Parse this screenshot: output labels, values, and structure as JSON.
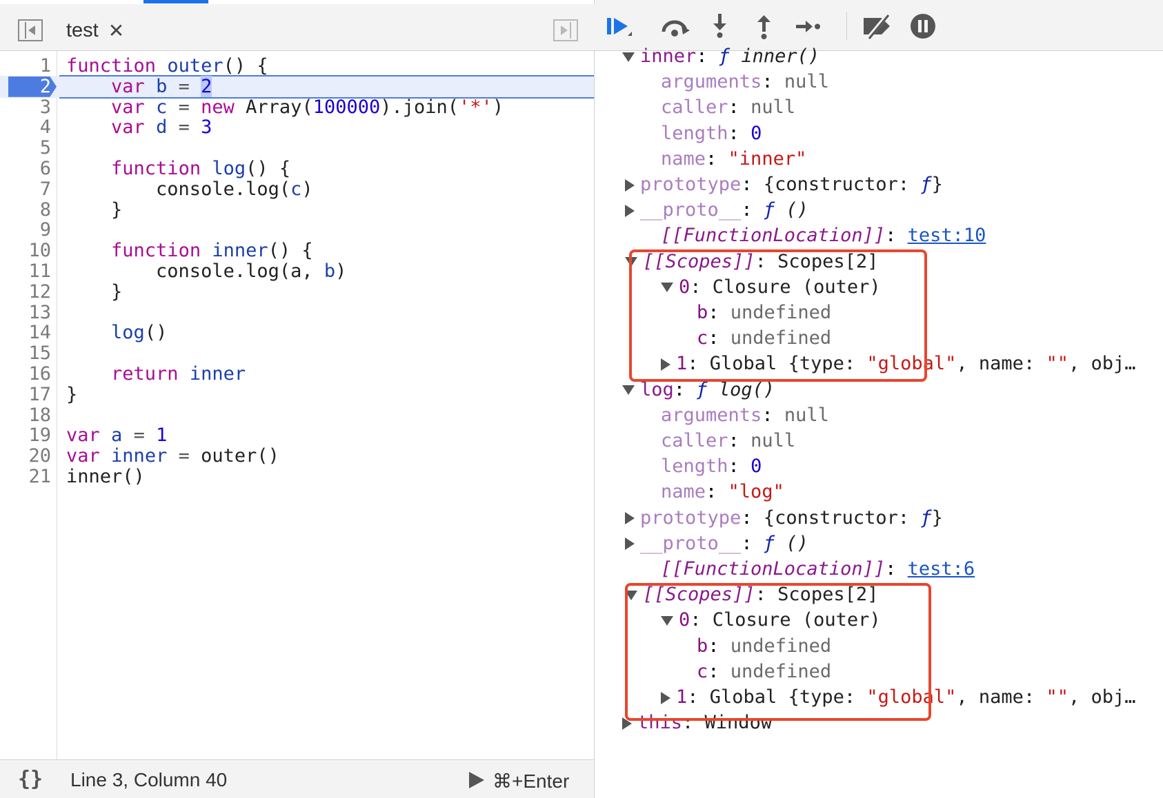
{
  "editor": {
    "file_tab": {
      "title": "test",
      "close_glyph": "✕"
    },
    "lines": [
      {
        "n": "1",
        "tokens": [
          {
            "t": "function",
            "c": "kw"
          },
          {
            "t": " "
          },
          {
            "t": "outer",
            "c": "def"
          },
          {
            "t": "() {"
          }
        ]
      },
      {
        "n": "2",
        "tokens": [
          {
            "t": "    "
          },
          {
            "t": "var",
            "c": "kw"
          },
          {
            "t": " "
          },
          {
            "t": "b",
            "c": "def"
          },
          {
            "t": " = ",
            "c": "op"
          },
          {
            "t": "2",
            "c": "num hl-value"
          }
        ],
        "paused": true
      },
      {
        "n": "3",
        "tokens": [
          {
            "t": "    "
          },
          {
            "t": "var",
            "c": "kw"
          },
          {
            "t": " "
          },
          {
            "t": "c",
            "c": "def"
          },
          {
            "t": " = ",
            "c": "op"
          },
          {
            "t": "new",
            "c": "kw"
          },
          {
            "t": " Array("
          },
          {
            "t": "100000",
            "c": "num"
          },
          {
            "t": ").join("
          },
          {
            "t": "'*'",
            "c": "str"
          },
          {
            "t": ")"
          }
        ]
      },
      {
        "n": "4",
        "tokens": [
          {
            "t": "    "
          },
          {
            "t": "var",
            "c": "kw"
          },
          {
            "t": " "
          },
          {
            "t": "d",
            "c": "def"
          },
          {
            "t": " = ",
            "c": "op"
          },
          {
            "t": "3",
            "c": "num"
          }
        ]
      },
      {
        "n": "5",
        "tokens": []
      },
      {
        "n": "6",
        "tokens": [
          {
            "t": "    "
          },
          {
            "t": "function",
            "c": "kw"
          },
          {
            "t": " "
          },
          {
            "t": "log",
            "c": "def"
          },
          {
            "t": "() {"
          }
        ]
      },
      {
        "n": "7",
        "tokens": [
          {
            "t": "        console.log("
          },
          {
            "t": "c",
            "c": "def"
          },
          {
            "t": ")"
          }
        ]
      },
      {
        "n": "8",
        "tokens": [
          {
            "t": "    }"
          }
        ]
      },
      {
        "n": "9",
        "tokens": []
      },
      {
        "n": "10",
        "tokens": [
          {
            "t": "    "
          },
          {
            "t": "function",
            "c": "kw"
          },
          {
            "t": " "
          },
          {
            "t": "inner",
            "c": "def"
          },
          {
            "t": "() {"
          }
        ]
      },
      {
        "n": "11",
        "tokens": [
          {
            "t": "        console.log(a, "
          },
          {
            "t": "b",
            "c": "def"
          },
          {
            "t": ")"
          }
        ]
      },
      {
        "n": "12",
        "tokens": [
          {
            "t": "    }"
          }
        ]
      },
      {
        "n": "13",
        "tokens": []
      },
      {
        "n": "14",
        "tokens": [
          {
            "t": "    "
          },
          {
            "t": "log",
            "c": "def"
          },
          {
            "t": "()"
          }
        ]
      },
      {
        "n": "15",
        "tokens": []
      },
      {
        "n": "16",
        "tokens": [
          {
            "t": "    "
          },
          {
            "t": "return",
            "c": "kw"
          },
          {
            "t": " "
          },
          {
            "t": "inner",
            "c": "def"
          }
        ]
      },
      {
        "n": "17",
        "tokens": [
          {
            "t": "}"
          }
        ]
      },
      {
        "n": "18",
        "tokens": []
      },
      {
        "n": "19",
        "tokens": [
          {
            "t": "var",
            "c": "kw"
          },
          {
            "t": " "
          },
          {
            "t": "a",
            "c": "def"
          },
          {
            "t": " = ",
            "c": "op"
          },
          {
            "t": "1",
            "c": "num"
          }
        ]
      },
      {
        "n": "20",
        "tokens": [
          {
            "t": "var",
            "c": "kw"
          },
          {
            "t": " "
          },
          {
            "t": "inner",
            "c": "def"
          },
          {
            "t": " = ",
            "c": "op"
          },
          {
            "t": "outer()"
          }
        ]
      },
      {
        "n": "21",
        "tokens": [
          {
            "t": "inner()"
          }
        ]
      }
    ]
  },
  "status_bar": {
    "pretty_print": "{}",
    "cursor_position": "Line 3, Column 40",
    "run_shortcut": "⌘+Enter"
  },
  "debug_toolbar": {
    "buttons": [
      "resume-icon",
      "step-over-icon",
      "step-into-icon",
      "step-out-icon",
      "step-icon",
      "deactivate-breakpoints-icon",
      "pause-on-exceptions-icon"
    ]
  },
  "scope_tree": {
    "rows": [
      {
        "indent": 0,
        "tri": "down",
        "parts": [
          {
            "t": "inner",
            "c": "k-main"
          },
          {
            "t": ": "
          },
          {
            "t": "ƒ",
            "c": "v-f"
          },
          {
            "t": " inner()",
            "c": "v-fn"
          }
        ]
      },
      {
        "indent": 2,
        "parts": [
          {
            "t": "arguments",
            "c": "k-dim"
          },
          {
            "t": ": "
          },
          {
            "t": "null",
            "c": "v-null"
          }
        ]
      },
      {
        "indent": 2,
        "parts": [
          {
            "t": "caller",
            "c": "k-dim"
          },
          {
            "t": ": "
          },
          {
            "t": "null",
            "c": "v-null"
          }
        ]
      },
      {
        "indent": 2,
        "parts": [
          {
            "t": "length",
            "c": "k-dim"
          },
          {
            "t": ": "
          },
          {
            "t": "0",
            "c": "v-num"
          }
        ]
      },
      {
        "indent": 2,
        "parts": [
          {
            "t": "name",
            "c": "k-dim"
          },
          {
            "t": ": "
          },
          {
            "t": "\"inner\"",
            "c": "v-str"
          }
        ]
      },
      {
        "indent": 1,
        "tri": "right",
        "parts": [
          {
            "t": "prototype",
            "c": "k-dim"
          },
          {
            "t": ": "
          },
          {
            "t": "{constructor: ",
            "c": "v-obj"
          },
          {
            "t": "ƒ",
            "c": "v-f"
          },
          {
            "t": "}",
            "c": "v-obj"
          }
        ]
      },
      {
        "indent": 1,
        "tri": "right",
        "parts": [
          {
            "t": "__proto__",
            "c": "k-dim"
          },
          {
            "t": ": "
          },
          {
            "t": "ƒ",
            "c": "v-f"
          },
          {
            "t": " ()",
            "c": "v-fn"
          }
        ]
      },
      {
        "indent": 2,
        "parts": [
          {
            "t": "[[FunctionLocation]]",
            "c": "internal"
          },
          {
            "t": ": "
          },
          {
            "t": "test:10",
            "c": "v-link"
          }
        ]
      },
      {
        "indent": 1,
        "tri": "down",
        "parts": [
          {
            "t": "[[Scopes]]",
            "c": "internal"
          },
          {
            "t": ": Scopes[2]",
            "c": "plain"
          }
        ]
      },
      {
        "indent": 2,
        "tri": "down",
        "tri_shift": true,
        "parts": [
          {
            "t": "0",
            "c": "k-name"
          },
          {
            "t": ": Closure (outer)",
            "c": "plain"
          }
        ]
      },
      {
        "indent": 3,
        "parts": [
          {
            "t": "b",
            "c": "k-name"
          },
          {
            "t": ": "
          },
          {
            "t": "undefined",
            "c": "v-undef"
          }
        ]
      },
      {
        "indent": 3,
        "parts": [
          {
            "t": "c",
            "c": "k-name"
          },
          {
            "t": ": "
          },
          {
            "t": "undefined",
            "c": "v-undef"
          }
        ]
      },
      {
        "indent": 2,
        "tri": "right",
        "tri_shift": true,
        "parts": [
          {
            "t": "1",
            "c": "k-name"
          },
          {
            "t": ": Global {type: ",
            "c": "plain"
          },
          {
            "t": "\"global\"",
            "c": "v-str"
          },
          {
            "t": ", name: ",
            "c": "plain"
          },
          {
            "t": "\"\"",
            "c": "v-str"
          },
          {
            "t": ", obj…",
            "c": "plain"
          }
        ]
      },
      {
        "indent": 0,
        "tri": "down",
        "parts": [
          {
            "t": "log",
            "c": "k-main"
          },
          {
            "t": ": "
          },
          {
            "t": "ƒ",
            "c": "v-f"
          },
          {
            "t": " log()",
            "c": "v-fn"
          }
        ]
      },
      {
        "indent": 2,
        "parts": [
          {
            "t": "arguments",
            "c": "k-dim"
          },
          {
            "t": ": "
          },
          {
            "t": "null",
            "c": "v-null"
          }
        ]
      },
      {
        "indent": 2,
        "parts": [
          {
            "t": "caller",
            "c": "k-dim"
          },
          {
            "t": ": "
          },
          {
            "t": "null",
            "c": "v-null"
          }
        ]
      },
      {
        "indent": 2,
        "parts": [
          {
            "t": "length",
            "c": "k-dim"
          },
          {
            "t": ": "
          },
          {
            "t": "0",
            "c": "v-num"
          }
        ]
      },
      {
        "indent": 2,
        "parts": [
          {
            "t": "name",
            "c": "k-dim"
          },
          {
            "t": ": "
          },
          {
            "t": "\"log\"",
            "c": "v-str"
          }
        ]
      },
      {
        "indent": 1,
        "tri": "right",
        "parts": [
          {
            "t": "prototype",
            "c": "k-dim"
          },
          {
            "t": ": "
          },
          {
            "t": "{constructor: ",
            "c": "v-obj"
          },
          {
            "t": "ƒ",
            "c": "v-f"
          },
          {
            "t": "}",
            "c": "v-obj"
          }
        ]
      },
      {
        "indent": 1,
        "tri": "right",
        "parts": [
          {
            "t": "__proto__",
            "c": "k-dim"
          },
          {
            "t": ": "
          },
          {
            "t": "ƒ",
            "c": "v-f"
          },
          {
            "t": " ()",
            "c": "v-fn"
          }
        ]
      },
      {
        "indent": 2,
        "parts": [
          {
            "t": "[[FunctionLocation]]",
            "c": "internal"
          },
          {
            "t": ": "
          },
          {
            "t": "test:6",
            "c": "v-link"
          }
        ]
      },
      {
        "indent": 1,
        "tri": "down",
        "parts": [
          {
            "t": "[[Scopes]]",
            "c": "internal"
          },
          {
            "t": ": Scopes[2]",
            "c": "plain"
          }
        ]
      },
      {
        "indent": 2,
        "tri": "down",
        "tri_shift": true,
        "parts": [
          {
            "t": "0",
            "c": "k-name"
          },
          {
            "t": ": Closure (outer)",
            "c": "plain"
          }
        ]
      },
      {
        "indent": 3,
        "parts": [
          {
            "t": "b",
            "c": "k-name"
          },
          {
            "t": ": "
          },
          {
            "t": "undefined",
            "c": "v-undef"
          }
        ]
      },
      {
        "indent": 3,
        "parts": [
          {
            "t": "c",
            "c": "k-name"
          },
          {
            "t": ": "
          },
          {
            "t": "undefined",
            "c": "v-undef"
          }
        ]
      },
      {
        "indent": 2,
        "tri": "right",
        "tri_shift": true,
        "parts": [
          {
            "t": "1",
            "c": "k-name"
          },
          {
            "t": ": Global {type: ",
            "c": "plain"
          },
          {
            "t": "\"global\"",
            "c": "v-str"
          },
          {
            "t": ", name: ",
            "c": "plain"
          },
          {
            "t": "\"\"",
            "c": "v-str"
          },
          {
            "t": ", obj…",
            "c": "plain"
          }
        ]
      },
      {
        "indent": 0,
        "tri": "right",
        "parts": [
          {
            "t": "this",
            "c": "k-main"
          },
          {
            "t": ": Window",
            "c": "plain"
          }
        ]
      }
    ]
  },
  "colors": {
    "highlight_box": "#e8462d",
    "paused_line": "#e8eefc",
    "exec_marker": "#4c7ce0",
    "accent": "#1a73e8"
  }
}
